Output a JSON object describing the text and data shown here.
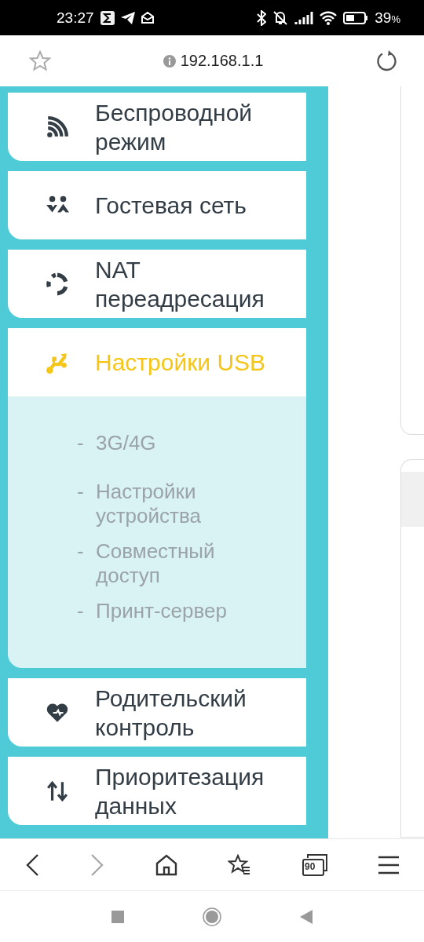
{
  "status_bar": {
    "time": "23:27",
    "battery": "39",
    "battery_unit": "%"
  },
  "address_bar": {
    "url": "192.168.1.1"
  },
  "menu": [
    {
      "label": "Беспроводной режим",
      "selected": false,
      "expanded": false
    },
    {
      "label": "Гостевая сеть",
      "selected": false,
      "expanded": false
    },
    {
      "label": "NAT переадресация",
      "selected": false,
      "expanded": false
    },
    {
      "label": "Настройки USB",
      "selected": true,
      "expanded": true,
      "children": [
        {
          "dash": "-",
          "label": "3G/4G"
        },
        {
          "dash": "-",
          "label": "Настройки устройства"
        },
        {
          "dash": "-",
          "label": "Совместный доступ"
        },
        {
          "dash": "-",
          "label": "Принт-сервер"
        }
      ]
    },
    {
      "label": "Родительский контроль",
      "selected": false,
      "expanded": false
    },
    {
      "label": "Приоритезация данных",
      "selected": false,
      "expanded": false
    }
  ],
  "browser_toolbar": {
    "tab_count": "90"
  }
}
